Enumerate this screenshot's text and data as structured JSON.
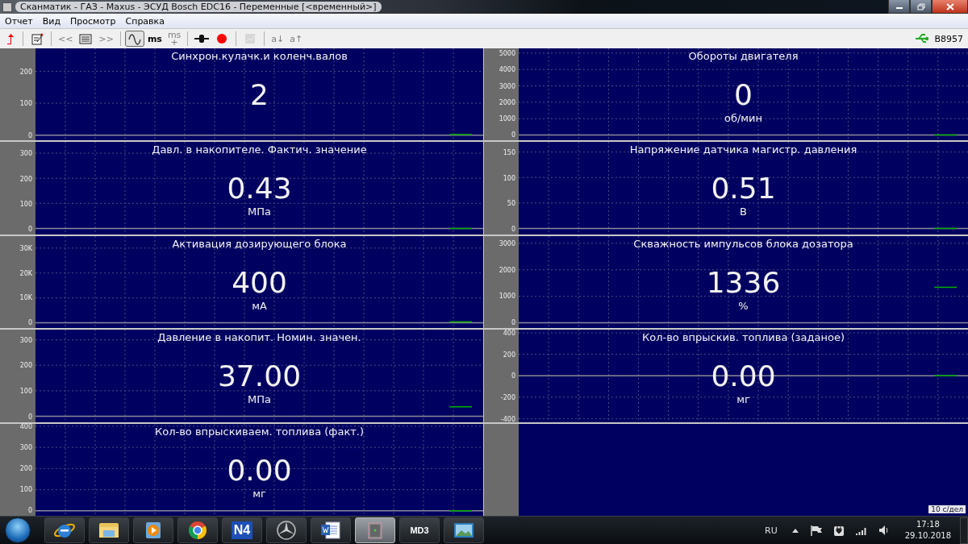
{
  "window": {
    "title": "Сканматик - ГАЗ - Maxus - ЭСУД Bosch EDC16 - Переменные [<временный>]"
  },
  "menu": [
    "Отчет",
    "Вид",
    "Просмотр",
    "Справка"
  ],
  "toolbar": {
    "groups": [
      [
        {
          "kind": "icon",
          "on": false,
          "disabled": false
        }
      ],
      [
        {
          "kind": "icon",
          "on": false,
          "disabled": false
        }
      ],
      [
        {
          "kind": "text",
          "text": "<<",
          "on": false,
          "disabled": true
        },
        {
          "kind": "icon",
          "on": false,
          "disabled": false
        },
        {
          "kind": "text",
          "text": ">>",
          "on": false,
          "disabled": true
        }
      ],
      [
        {
          "kind": "icon",
          "on": true,
          "disabled": false
        },
        {
          "kind": "text",
          "text": "ms",
          "on": false,
          "disabled": false
        },
        {
          "kind": "text",
          "text": "ms\n+",
          "on": false,
          "disabled": true
        }
      ],
      [
        {
          "kind": "icon",
          "on": false,
          "disabled": false
        },
        {
          "kind": "icon",
          "on": false,
          "disabled": false
        }
      ],
      [
        {
          "kind": "icon",
          "on": false,
          "disabled": true
        }
      ],
      [
        {
          "kind": "text",
          "text": "a↓",
          "on": false,
          "disabled": true
        },
        {
          "kind": "text",
          "text": "a↑",
          "on": false,
          "disabled": true
        }
      ]
    ],
    "device": "B8957"
  },
  "columns": [
    {
      "panels": [
        {
          "title": "Синхрон.кулачк.и коленч.валов",
          "value": "2",
          "chart_data": {
            "type": "line",
            "grid": true,
            "ylim": [
              -17,
              272
            ],
            "yticks": [
              0,
              100,
              200
            ],
            "series": [
              {
                "color": "#00b000",
                "values": [
                  null,
                  null,
                  null,
                  null,
                  null,
                  null,
                  null,
                  null,
                  null,
                  null,
                  null,
                  null,
                  null,
                  null,
                  null,
                  null,
                  null,
                  null,
                  2,
                  2
                ]
              }
            ]
          }
        },
        {
          "title": "Давл. в накопителе. Фактич. значение",
          "value": "0.43",
          "unit": "МПа",
          "chart_data": {
            "type": "line",
            "grid": true,
            "ylim": [
              -22,
              345
            ],
            "yticks": [
              0,
              100,
              200,
              300
            ],
            "series": [
              {
                "color": "#00b000",
                "values": [
                  null,
                  null,
                  null,
                  null,
                  null,
                  null,
                  null,
                  null,
                  null,
                  null,
                  null,
                  null,
                  null,
                  null,
                  null,
                  null,
                  null,
                  null,
                  0,
                  0
                ]
              }
            ]
          }
        },
        {
          "title": "Активация дозирующего блока",
          "value": "400",
          "unit": "мА",
          "chart_data": {
            "type": "line",
            "grid": true,
            "ylim": [
              -2200,
              34800
            ],
            "yticks": [
              {
                "value": 0,
                "label": "0"
              },
              {
                "value": 10000,
                "label": "10K"
              },
              {
                "value": 20000,
                "label": "20K"
              },
              {
                "value": 30000,
                "label": "30K"
              }
            ],
            "series": [
              {
                "color": "#00b000",
                "values": [
                  null,
                  null,
                  null,
                  null,
                  null,
                  null,
                  null,
                  null,
                  null,
                  null,
                  null,
                  null,
                  null,
                  null,
                  null,
                  null,
                  null,
                  null,
                  400,
                  400
                ]
              }
            ]
          }
        },
        {
          "title": "Давление в накопит. Номин. значен.",
          "value": "37.00",
          "unit": "МПа",
          "chart_data": {
            "type": "line",
            "grid": true,
            "ylim": [
              -22,
              340
            ],
            "yticks": [
              0,
              100,
              200,
              300
            ],
            "series": [
              {
                "color": "#00b000",
                "values": [
                  null,
                  null,
                  null,
                  null,
                  null,
                  null,
                  null,
                  null,
                  null,
                  null,
                  null,
                  null,
                  null,
                  null,
                  null,
                  null,
                  null,
                  null,
                  37,
                  37
                ]
              }
            ]
          }
        },
        {
          "title": "Кол-во впрыскиваем. топлива (факт.)",
          "value": "0.00",
          "unit": "мг",
          "chart_data": {
            "type": "line",
            "grid": true,
            "ylim": [
              -25,
              411
            ],
            "yticks": [
              0,
              100,
              200,
              300,
              400
            ],
            "series": [
              {
                "color": "#00b000",
                "values": [
                  null,
                  null,
                  null,
                  null,
                  null,
                  null,
                  null,
                  null,
                  null,
                  null,
                  null,
                  null,
                  null,
                  null,
                  null,
                  null,
                  null,
                  null,
                  0,
                  0
                ]
              }
            ]
          }
        }
      ]
    },
    {
      "panels": [
        {
          "title": "Обороты  двигателя",
          "value": "0",
          "unit": "об/мин",
          "chart_data": {
            "type": "line",
            "grid": true,
            "ylim": [
              -340,
              5290
            ],
            "yticks": [
              0,
              1000,
              2000,
              3000,
              4000,
              5000
            ],
            "series": [
              {
                "color": "#00b000",
                "values": [
                  null,
                  null,
                  null,
                  null,
                  null,
                  null,
                  null,
                  null,
                  null,
                  null,
                  null,
                  null,
                  null,
                  null,
                  null,
                  null,
                  null,
                  null,
                  0,
                  0
                ]
              }
            ]
          }
        },
        {
          "title": "Напряжение датчика магистр. давления",
          "value": "0.51",
          "unit": "В",
          "chart_data": {
            "type": "line",
            "grid": true,
            "ylim": [
              -11,
              170
            ],
            "yticks": [
              0,
              50,
              100,
              150
            ],
            "series": [
              {
                "color": "#00b000",
                "values": [
                  null,
                  null,
                  null,
                  null,
                  null,
                  null,
                  null,
                  null,
                  null,
                  null,
                  null,
                  null,
                  null,
                  null,
                  null,
                  null,
                  null,
                  null,
                  0,
                  0
                ]
              }
            ]
          }
        },
        {
          "title": "Скважность импульсов блока дозатора",
          "value": "1336",
          "unit": "%",
          "chart_data": {
            "type": "line",
            "grid": true,
            "ylim": [
              -210,
              3270
            ],
            "yticks": [
              0,
              1000,
              2000,
              3000
            ],
            "series": [
              {
                "color": "#00b000",
                "values": [
                  null,
                  null,
                  null,
                  null,
                  null,
                  null,
                  null,
                  null,
                  null,
                  null,
                  null,
                  null,
                  null,
                  null,
                  null,
                  null,
                  null,
                  null,
                  1340,
                  1340
                ]
              }
            ]
          }
        },
        {
          "title": "Кол-во впрыскив. топлива (заданое)",
          "value": "0.00",
          "unit": "мг",
          "chart_data": {
            "type": "line",
            "grid": true,
            "ylim": [
              -430,
              430
            ],
            "yticks": [
              -400,
              -200,
              0,
              200,
              400
            ],
            "series": [
              {
                "color": "#00b000",
                "values": [
                  null,
                  null,
                  null,
                  null,
                  null,
                  null,
                  null,
                  null,
                  null,
                  null,
                  null,
                  null,
                  null,
                  null,
                  null,
                  null,
                  null,
                  null,
                  0,
                  0
                ]
              }
            ]
          }
        }
      ]
    }
  ],
  "time_scale": "10 с/дел",
  "taskbar": {
    "apps": [
      {
        "kind": "icon",
        "active": false
      },
      {
        "kind": "icon",
        "active": false
      },
      {
        "kind": "icon",
        "active": false
      },
      {
        "kind": "icon",
        "active": false
      },
      {
        "kind": "text",
        "text": "N4",
        "active": false
      },
      {
        "kind": "icon",
        "active": false
      },
      {
        "kind": "icon",
        "active": false
      },
      {
        "kind": "icon",
        "active": true
      },
      {
        "kind": "text",
        "text": "MD3",
        "active": false
      },
      {
        "kind": "icon",
        "active": false
      }
    ],
    "language": "RU",
    "time": "17:18",
    "date": "29.10.2018"
  }
}
